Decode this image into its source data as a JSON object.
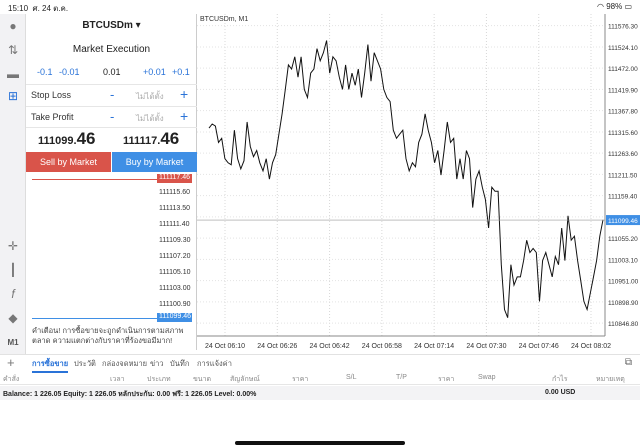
{
  "status": {
    "time": "15:10",
    "date": "ศ. 24 ต.ค.",
    "battery": "98%"
  },
  "panel": {
    "symbol": "BTCUSDm",
    "execution": "Market Execution",
    "lot_steps_minus": [
      "-0.1",
      "-0.01"
    ],
    "lot_value": "0.01",
    "lot_steps_plus": [
      "+0.01",
      "+0.1"
    ],
    "stop_loss_label": "Stop Loss",
    "take_profit_label": "Take Profit",
    "not_set": "ไม่ได้ตั้ง",
    "minus": "-",
    "plus": "+",
    "bid_main": "111099.",
    "bid_big": "46",
    "ask_main": "111117.",
    "ask_big": "46",
    "sell_label": "Sell by Market",
    "buy_label": "Buy by Market",
    "ladder_levels": [
      "111115.60",
      "111113.50",
      "111111.40",
      "111109.30",
      "111107.20",
      "111105.10",
      "111103.00",
      "111100.90"
    ],
    "ask_tag": "111117.46",
    "bid_tag": "111099.46",
    "warning": "คำเตือน! การซื้อขายจะถูกดำเนินการตามสภาพตลาด ความแตกต่างกับราคาที่ร้องขอมีมาก!"
  },
  "chart_data": {
    "type": "line",
    "title": "BTCUSDm, M1",
    "x_tick_labels": [
      "24 Oct 06:10",
      "24 Oct 06:26",
      "24 Oct 06:42",
      "24 Oct 06:58",
      "24 Oct 07:14",
      "24 Oct 07:30",
      "24 Oct 07:46",
      "24 Oct 08:02"
    ],
    "y_tick_labels": [
      "111576.30",
      "111524.10",
      "111472.00",
      "111419.90",
      "111367.80",
      "111315.60",
      "111263.60",
      "111211.50",
      "111159.40",
      "111107.30",
      "111055.20",
      "111003.10",
      "110951.00",
      "110898.90",
      "110846.80"
    ],
    "ylim": [
      110820,
      111600
    ],
    "current_price_label": "111099.46",
    "current_price": 111099.46,
    "x": [
      0,
      1,
      2,
      3,
      4,
      5,
      6,
      7,
      8,
      9,
      10,
      11,
      12,
      13,
      14,
      15,
      16,
      17,
      18,
      19,
      20,
      21,
      22,
      23,
      24,
      25,
      26,
      27,
      28,
      29,
      30,
      31,
      32,
      33,
      34,
      35,
      36,
      37,
      38,
      39,
      40,
      41,
      42,
      43,
      44,
      45,
      46,
      47,
      48,
      49,
      50,
      51,
      52,
      53,
      54,
      55,
      56,
      57,
      58,
      59,
      60,
      61,
      62,
      63,
      64,
      65,
      66,
      67,
      68,
      69,
      70,
      71,
      72,
      73,
      74,
      75,
      76,
      77,
      78,
      79,
      80,
      81,
      82,
      83,
      84,
      85,
      86,
      87,
      88,
      89,
      90,
      91,
      92,
      93,
      94,
      95,
      96,
      97,
      98,
      99,
      100,
      101,
      102,
      103,
      104,
      105,
      106,
      107,
      108,
      109,
      110,
      111,
      112,
      113,
      114,
      115,
      116,
      117,
      118,
      119,
      120,
      121,
      122,
      123,
      124
    ],
    "values": [
      111325,
      111335,
      111330,
      111290,
      111300,
      111250,
      111240,
      111235,
      111320,
      111250,
      111225,
      111245,
      111340,
      111280,
      111255,
      111270,
      111240,
      111220,
      111250,
      111200,
      111240,
      111260,
      111310,
      111360,
      111420,
      111480,
      111470,
      111500,
      111450,
      111500,
      111420,
      111400,
      111460,
      111470,
      111520,
      111490,
      111510,
      111540,
      111460,
      111500,
      111490,
      111450,
      111420,
      111480,
      111420,
      111460,
      111430,
      111470,
      111400,
      111460,
      111530,
      111440,
      111510,
      111490,
      111470,
      111420,
      111400,
      111390,
      111320,
      111300,
      111310,
      111320,
      111250,
      111220,
      111240,
      111230,
      111290,
      111310,
      111360,
      111320,
      111290,
      111240,
      111270,
      111210,
      111270,
      111340,
      111290,
      111300,
      111200,
      111250,
      111200,
      111270,
      111250,
      111130,
      111200,
      111220,
      111180,
      111150,
      111080,
      111180,
      111170,
      111170,
      110990,
      110880,
      110860,
      110990,
      110940,
      110960,
      110960,
      111000,
      111050,
      111020,
      111030,
      111020,
      110900,
      111000,
      111020,
      110990,
      110960,
      111010,
      110990,
      111080,
      111000,
      111110,
      111050,
      111060,
      111000,
      110950,
      110900,
      110880,
      110920,
      110960,
      111000,
      111060,
      111100
    ]
  },
  "bottom": {
    "tabs": [
      "การซื้อขาย",
      "ประวัติ",
      "กล่องจดหมาย",
      "ข่าว",
      "บันทึก",
      "การแจ้งค่า"
    ],
    "columns": [
      "คำสั่ง",
      "เวลา",
      "ประเภท",
      "ขนาด",
      "สัญลักษณ์",
      "ราคา",
      "S/L",
      "T/P",
      "ราคา",
      "Swap",
      "กำไร",
      "หมายเหตุ"
    ],
    "balance_text": "Balance: 1 226.05 Equity: 1 226.05 หลักประกัน: 0.00 ฟรี: 1 226.05 Level: 0.00%",
    "profit_amount": "0.00  USD"
  },
  "colors": {
    "sell": "#d9544a",
    "buy": "#3f8fe5",
    "accent": "#2a73d8"
  },
  "toolbar": {
    "timeframe": "M1"
  }
}
